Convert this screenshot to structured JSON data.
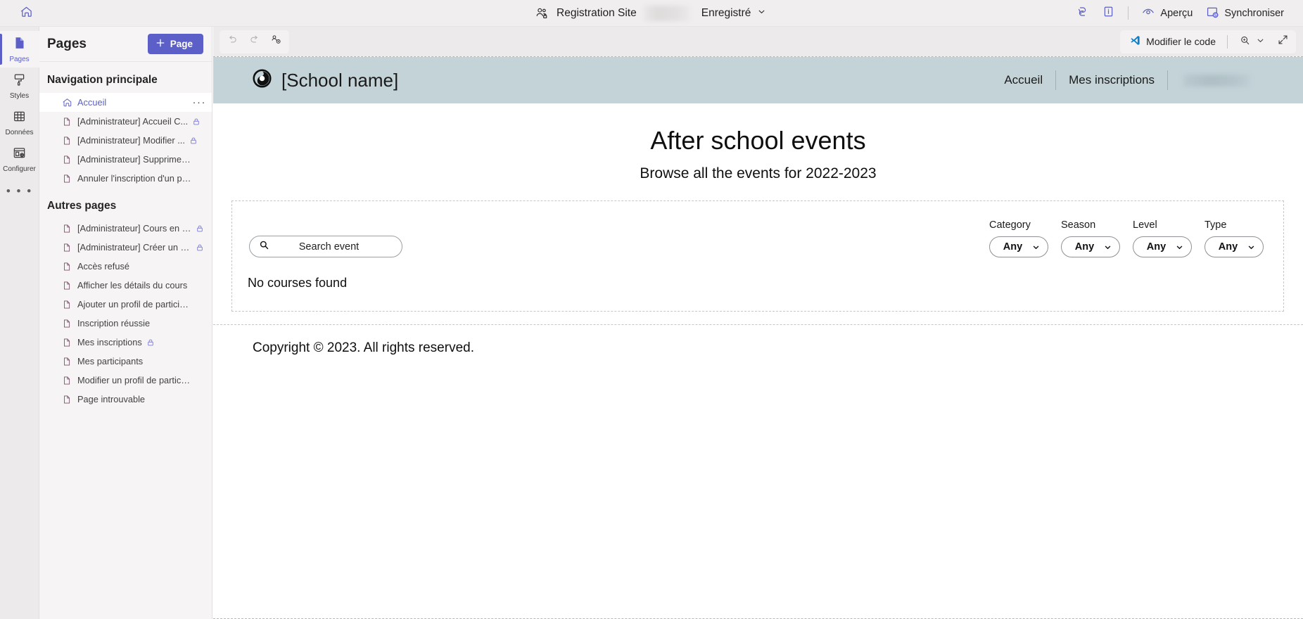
{
  "topbar": {
    "home_icon": "home-icon",
    "people_icon": "people-lock-icon",
    "site_name": "Registration Site",
    "site_redacted": "",
    "save_state": "Enregistré",
    "chevron_icon": "chevron-down-icon",
    "right_items": [
      {
        "icon": "copilot-icon",
        "label": ""
      },
      {
        "icon": "info-panel-icon",
        "label": ""
      }
    ],
    "preview_label": "Aperçu",
    "preview_icon": "eye-icon",
    "sync_label": "Synchroniser",
    "sync_icon": "sync-cloud-icon"
  },
  "rail": {
    "items": [
      {
        "label": "Pages",
        "icon": "pages-icon",
        "active": true
      },
      {
        "label": "Styles",
        "icon": "brush-icon",
        "active": false
      },
      {
        "label": "Données",
        "icon": "table-icon",
        "active": false
      },
      {
        "label": "Configurer",
        "icon": "configure-icon",
        "active": false
      }
    ],
    "more_icon": "ellipsis-icon"
  },
  "pages_panel": {
    "title": "Pages",
    "add_button": "Page",
    "add_icon": "plus-icon",
    "groups": [
      {
        "title": "Navigation principale",
        "items": [
          {
            "label": "Accueil",
            "icon": "home-icon",
            "selected": true,
            "locked": false,
            "overflow": "..."
          },
          {
            "label": "[Administrateur] Accueil C...",
            "icon": "page-icon",
            "selected": false,
            "locked": true
          },
          {
            "label": "[Administrateur] Modifier ...",
            "icon": "page-icon",
            "selected": false,
            "locked": true
          },
          {
            "label": "[Administrateur] Supprimer le c...",
            "icon": "page-icon",
            "selected": false,
            "locked": false
          },
          {
            "label": "Annuler l'inscription d'un partic...",
            "icon": "page-icon",
            "selected": false,
            "locked": false
          }
        ]
      },
      {
        "title": "Autres pages",
        "items": [
          {
            "label": "[Administrateur] Cours en d...",
            "icon": "page-icon",
            "selected": false,
            "locked": true
          },
          {
            "label": "[Administrateur] Créer un c...",
            "icon": "page-icon",
            "selected": false,
            "locked": true
          },
          {
            "label": "Accès refusé",
            "icon": "page-icon",
            "selected": false,
            "locked": false
          },
          {
            "label": "Afficher les détails du cours",
            "icon": "page-icon",
            "selected": false,
            "locked": false
          },
          {
            "label": "Ajouter un profil de participant",
            "icon": "page-icon",
            "selected": false,
            "locked": false
          },
          {
            "label": "Inscription réussie",
            "icon": "page-icon",
            "selected": false,
            "locked": false
          },
          {
            "label": "Mes inscriptions",
            "icon": "page-icon",
            "selected": false,
            "locked": true
          },
          {
            "label": "Mes participants",
            "icon": "page-icon",
            "selected": false,
            "locked": false
          },
          {
            "label": "Modifier un profil de participant",
            "icon": "page-icon",
            "selected": false,
            "locked": false
          },
          {
            "label": "Page introuvable",
            "icon": "page-icon",
            "selected": false,
            "locked": false
          }
        ]
      }
    ]
  },
  "canvas_toolbar": {
    "undo_icon": "undo-icon",
    "redo_icon": "redo-icon",
    "link_icon": "link-page-icon",
    "edit_code_label": "Modifier le code",
    "edit_code_icon": "vscode-icon",
    "zoom_icon": "zoom-in-icon",
    "zoom_chevron_icon": "chevron-down-icon",
    "expand_icon": "expand-icon"
  },
  "site": {
    "brand_logo_icon": "school-logo-icon",
    "brand_name": "[School name]",
    "nav": [
      {
        "label": "Accueil"
      },
      {
        "label": "Mes inscriptions"
      }
    ],
    "user_redacted": "",
    "page_title": "After school events",
    "page_subtitle": "Browse all the events for 2022-2023",
    "search": {
      "icon": "search-icon",
      "placeholder": "Search event",
      "value": ""
    },
    "filters": [
      {
        "label": "Category",
        "value": "Any",
        "caret_icon": "chevron-down-icon"
      },
      {
        "label": "Season",
        "value": "Any",
        "caret_icon": "chevron-down-icon"
      },
      {
        "label": "Level",
        "value": "Any",
        "caret_icon": "chevron-down-icon"
      },
      {
        "label": "Type",
        "value": "Any",
        "caret_icon": "chevron-down-icon"
      }
    ],
    "empty_message": "No courses found",
    "footer": "Copyright © 2023. All rights reserved."
  },
  "colors": {
    "accent": "#5b5fc7",
    "site_header_bg": "#c3d3d8",
    "rail_bg": "#eceaea",
    "panel_bg": "#f6f4f4"
  }
}
